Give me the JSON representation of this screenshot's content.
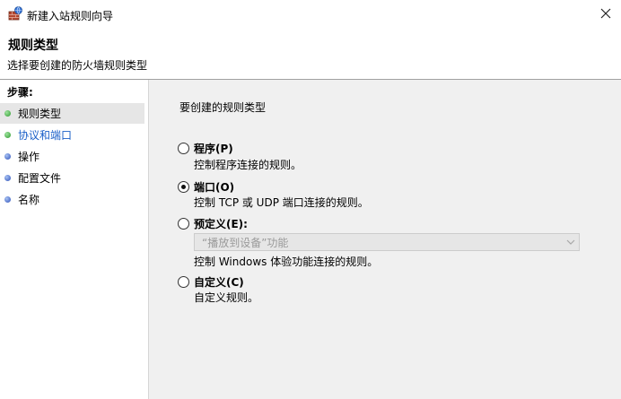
{
  "window": {
    "title": "新建入站规则向导",
    "icon": "firewall-wizard-icon",
    "close_icon": "close-icon"
  },
  "header": {
    "title": "规则类型",
    "subtitle": "选择要创建的防火墙规则类型"
  },
  "sidebar": {
    "heading": "步骤:",
    "steps": [
      {
        "label": "规则类型",
        "dot_color": "green",
        "current": true,
        "link": false
      },
      {
        "label": "协议和端口",
        "dot_color": "green",
        "current": false,
        "link": true
      },
      {
        "label": "操作",
        "dot_color": "blue",
        "current": false,
        "link": false
      },
      {
        "label": "配置文件",
        "dot_color": "blue",
        "current": false,
        "link": false
      },
      {
        "label": "名称",
        "dot_color": "blue",
        "current": false,
        "link": false
      }
    ]
  },
  "main": {
    "question": "要创建的规则类型",
    "options": [
      {
        "label": "程序(P)",
        "description": "控制程序连接的规则。",
        "checked": false
      },
      {
        "label": "端口(O)",
        "description": "控制 TCP 或 UDP 端口连接的规则。",
        "checked": true
      },
      {
        "label": "预定义(E):",
        "description": "控制 Windows 体验功能连接的规则。",
        "checked": false
      },
      {
        "label": "自定义(C)",
        "description": "自定义规则。",
        "checked": false
      }
    ],
    "predefined_dropdown": {
      "value": "“播放到设备”功能",
      "enabled": false
    }
  },
  "colors": {
    "main_background": "#f0f0f0",
    "link": "#1a5fc8",
    "current_step_highlight": "#e6e6e6"
  }
}
